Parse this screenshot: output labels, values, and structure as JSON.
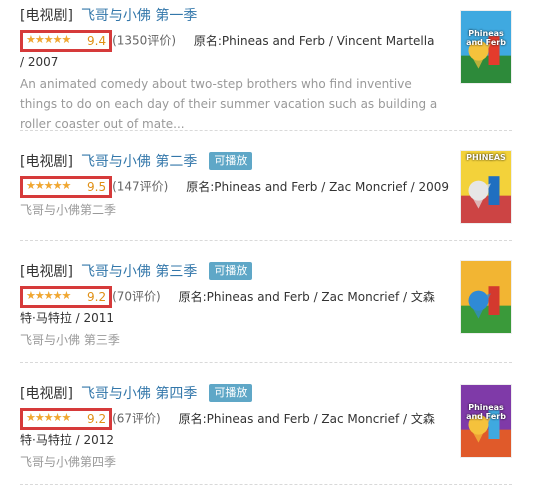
{
  "results": [
    {
      "category": "[电视剧]",
      "title": "飞哥与小佛 第一季",
      "badge": "",
      "rating_stars": 0.94,
      "score": "9.4",
      "ratings_count": "(1350评价)",
      "original": "原名:Phineas and Ferb / Vincent Martella / 2007",
      "description": "An animated comedy about two-step brothers who find inventive things to do on each day of their summer vacation such as building a roller coaster out of mate...",
      "poster_text": "Phineas and Ferb",
      "poster_colors": [
        "#3fa9e0",
        "#e43b2c",
        "#f5c23c",
        "#2d8a3a"
      ]
    },
    {
      "category": "[电视剧]",
      "title": "飞哥与小佛 第二季",
      "badge": "可播放",
      "rating_stars": 0.95,
      "score": "9.5",
      "ratings_count": "(147评价)",
      "original": "原名:Phineas and Ferb / Zac Moncrief / 2009",
      "description": "飞哥与小佛第二季",
      "poster_text": "PHINEAS",
      "poster_colors": [
        "#f3d23a",
        "#1f6fc0",
        "#e6e6e6",
        "#c44"
      ]
    },
    {
      "category": "[电视剧]",
      "title": "飞哥与小佛 第三季",
      "badge": "可播放",
      "rating_stars": 0.92,
      "score": "9.2",
      "ratings_count": "(70评价)",
      "original": "原名:Phineas and Ferb / Zac Moncrief / 文森特·马特拉 / 2011",
      "description": "飞哥与小佛 第三季",
      "poster_text": "",
      "poster_colors": [
        "#f2b533",
        "#d4392e",
        "#2f8ad6",
        "#3a9a3a"
      ]
    },
    {
      "category": "[电视剧]",
      "title": "飞哥与小佛 第四季",
      "badge": "可播放",
      "rating_stars": 0.9,
      "score": "9.2",
      "ratings_count": "(67评价)",
      "original": "原名:Phineas and Ferb / Zac Moncrief / 文森特·马特拉 / 2012",
      "description": "飞哥与小佛第四季",
      "poster_text": "Phineas and Ferb",
      "poster_colors": [
        "#7f3aa8",
        "#3fa9e0",
        "#f5c23c",
        "#e05a2a"
      ]
    }
  ]
}
